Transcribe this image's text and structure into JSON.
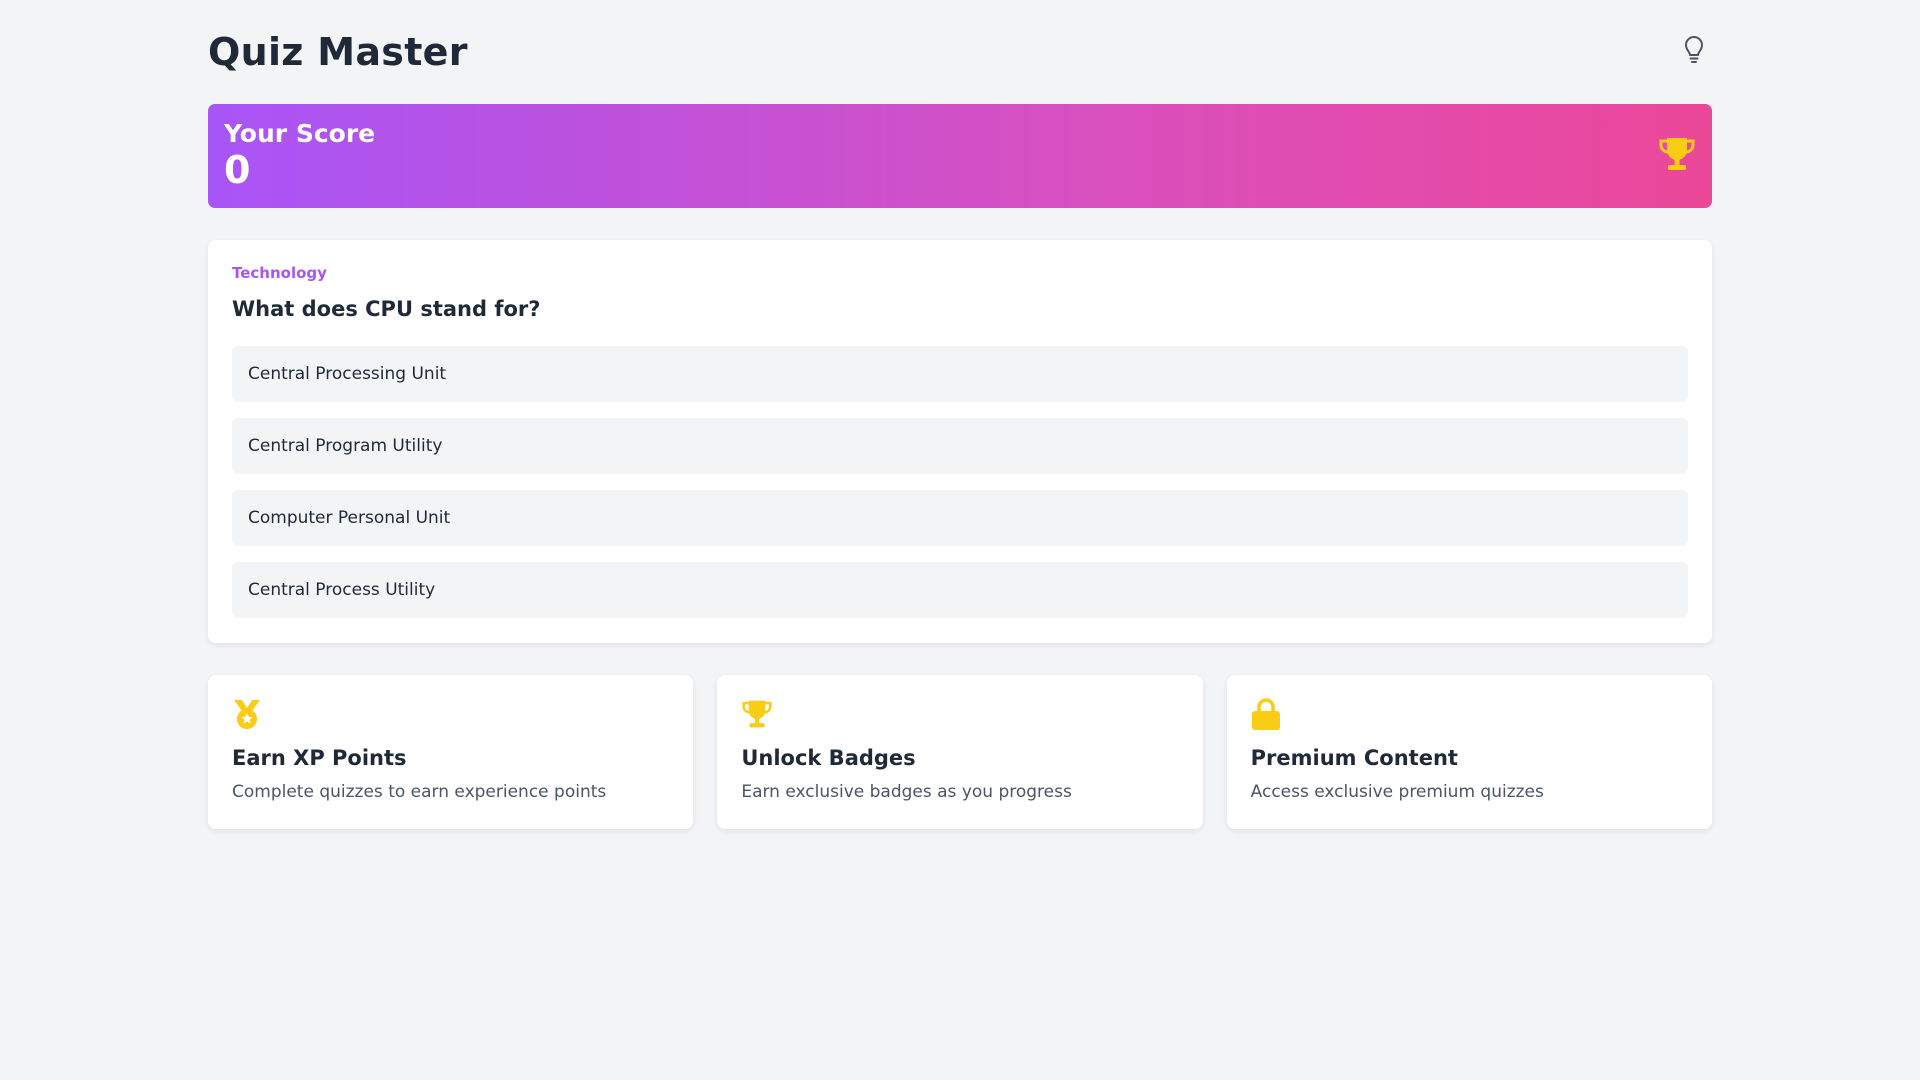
{
  "header": {
    "title": "Quiz Master",
    "hint_icon": "lightbulb-icon"
  },
  "score": {
    "label": "Your Score",
    "value": "0",
    "icon": "trophy-icon",
    "gradient_start": "#a855f7",
    "gradient_end": "#ec4899"
  },
  "quiz": {
    "category": "Technology",
    "question": "What does CPU stand for?",
    "options": [
      "Central Processing Unit",
      "Central Program Utility",
      "Computer Personal Unit",
      "Central Process Utility"
    ]
  },
  "features": [
    {
      "icon": "medal-icon",
      "title": "Earn XP Points",
      "description": "Complete quizzes to earn experience points"
    },
    {
      "icon": "trophy-icon",
      "title": "Unlock Badges",
      "description": "Earn exclusive badges as you progress"
    },
    {
      "icon": "lock-icon",
      "title": "Premium Content",
      "description": "Access exclusive premium quizzes"
    }
  ],
  "colors": {
    "accent": "#a855f7",
    "icon_gold": "#facc15",
    "background": "#f3f4f6"
  }
}
